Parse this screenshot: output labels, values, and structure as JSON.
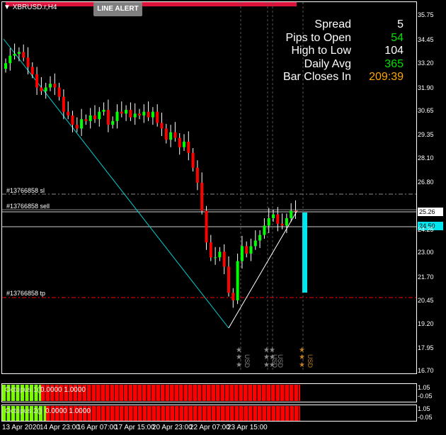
{
  "window": {
    "symbol": "XBRUSD.r,H4",
    "alert_button": "LINE ALERT"
  },
  "info_panel": [
    {
      "label": "Spread",
      "value": "5",
      "color": "#ffffff"
    },
    {
      "label": "Pips to Open",
      "value": "54",
      "color": "#00e000"
    },
    {
      "label": "High to Low",
      "value": "104",
      "color": "#ffffff"
    },
    {
      "label": "Daily Avg",
      "value": "365",
      "color": "#00e000"
    },
    {
      "label": "Bar Closes In",
      "value": "209:39",
      "color": "#ffa500"
    }
  ],
  "order_lines": {
    "sl": "#13766858 sl",
    "sell": "#13766858 sell",
    "tp": "#13766858 tp"
  },
  "price_axis": [
    "35.75",
    "34.45",
    "33.20",
    "31.90",
    "30.65",
    "29.35",
    "28.10",
    "26.80",
    "24.25",
    "23.00",
    "21.70",
    "20.45",
    "19.20",
    "17.95",
    "16.70"
  ],
  "current_ask": "25.26",
  "current_bid": "24.50",
  "news_label": "USD",
  "indicators": [
    {
      "label": "Octopus 1()",
      "values": "0.0000 1.0000",
      "max": "1.05",
      "min": "-0.05"
    },
    {
      "label": "Octopus 2()",
      "values": "0.0000 1.0000",
      "max": "1.05",
      "min": "-0.05"
    }
  ],
  "time_axis": [
    "13 Apr 2020",
    "14 Apr 23:00",
    "16 Apr 07:00",
    "17 Apr 15:00",
    "20 Apr 23:00",
    "22 Apr 07:00",
    "23 Apr 15:00"
  ],
  "chart_data": {
    "type": "candlestick",
    "ylim": [
      16.7,
      35.75
    ],
    "closes": [
      33.2,
      33.6,
      33.7,
      33.8,
      33.5,
      33.0,
      32.6,
      31.9,
      31.7,
      31.9,
      32.1,
      31.9,
      31.4,
      30.6,
      30.4,
      29.9,
      29.7,
      30.2,
      30.1,
      30.4,
      30.2,
      30.6,
      30.7,
      29.9,
      30.1,
      30.6,
      30.5,
      30.7,
      30.3,
      30.5,
      30.4,
      30.6,
      30.3,
      30.6,
      30.0,
      29.7,
      29.1,
      29.5,
      29.2,
      28.7,
      29.0,
      28.4,
      27.6,
      26.8,
      25.3,
      23.6,
      22.8,
      22.8,
      23.1,
      22.3,
      20.9,
      20.5,
      22.6,
      23.4,
      23.0,
      23.4,
      23.7,
      24.0,
      24.5,
      24.9,
      25.1,
      24.6,
      24.5,
      24.9,
      25.3,
      25.26
    ]
  }
}
